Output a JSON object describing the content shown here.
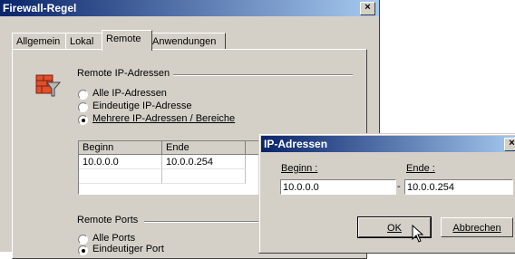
{
  "main_window": {
    "title": "Firewall-Regel",
    "close": "×",
    "tabs": [
      {
        "label": "Allgemein"
      },
      {
        "label": "Lokal"
      },
      {
        "label": "Remote"
      },
      {
        "label": "Anwendungen"
      }
    ],
    "remote_ip": {
      "group_label": "Remote IP-Adressen",
      "options": [
        {
          "label": "Alle IP-Adressen",
          "selected": false
        },
        {
          "label": "Eindeutige IP-Adresse",
          "selected": false
        },
        {
          "label": "Mehrere IP-Adressen / Bereiche",
          "selected": true
        }
      ],
      "columns": [
        "Beginn",
        "Ende"
      ],
      "rows": [
        {
          "begin": "10.0.0.0",
          "end": "10.0.0.254"
        }
      ]
    },
    "remote_ports": {
      "group_label": "Remote Ports",
      "options": [
        {
          "label": "Alle Ports",
          "selected": false
        },
        {
          "label": "Eindeutiger Port",
          "selected": true
        }
      ]
    }
  },
  "dialog": {
    "title": "IP-Adressen",
    "close": "×",
    "begin_label": "Beginn :",
    "end_label": "Ende :",
    "begin_value": "10.0.0.0",
    "end_value": "10.0.0.254",
    "separator": "-",
    "ok_label": "OK",
    "cancel_label": "Abbrechen"
  },
  "colors": {
    "titlebar": "#0a246a",
    "face": "#d4d0c8"
  }
}
